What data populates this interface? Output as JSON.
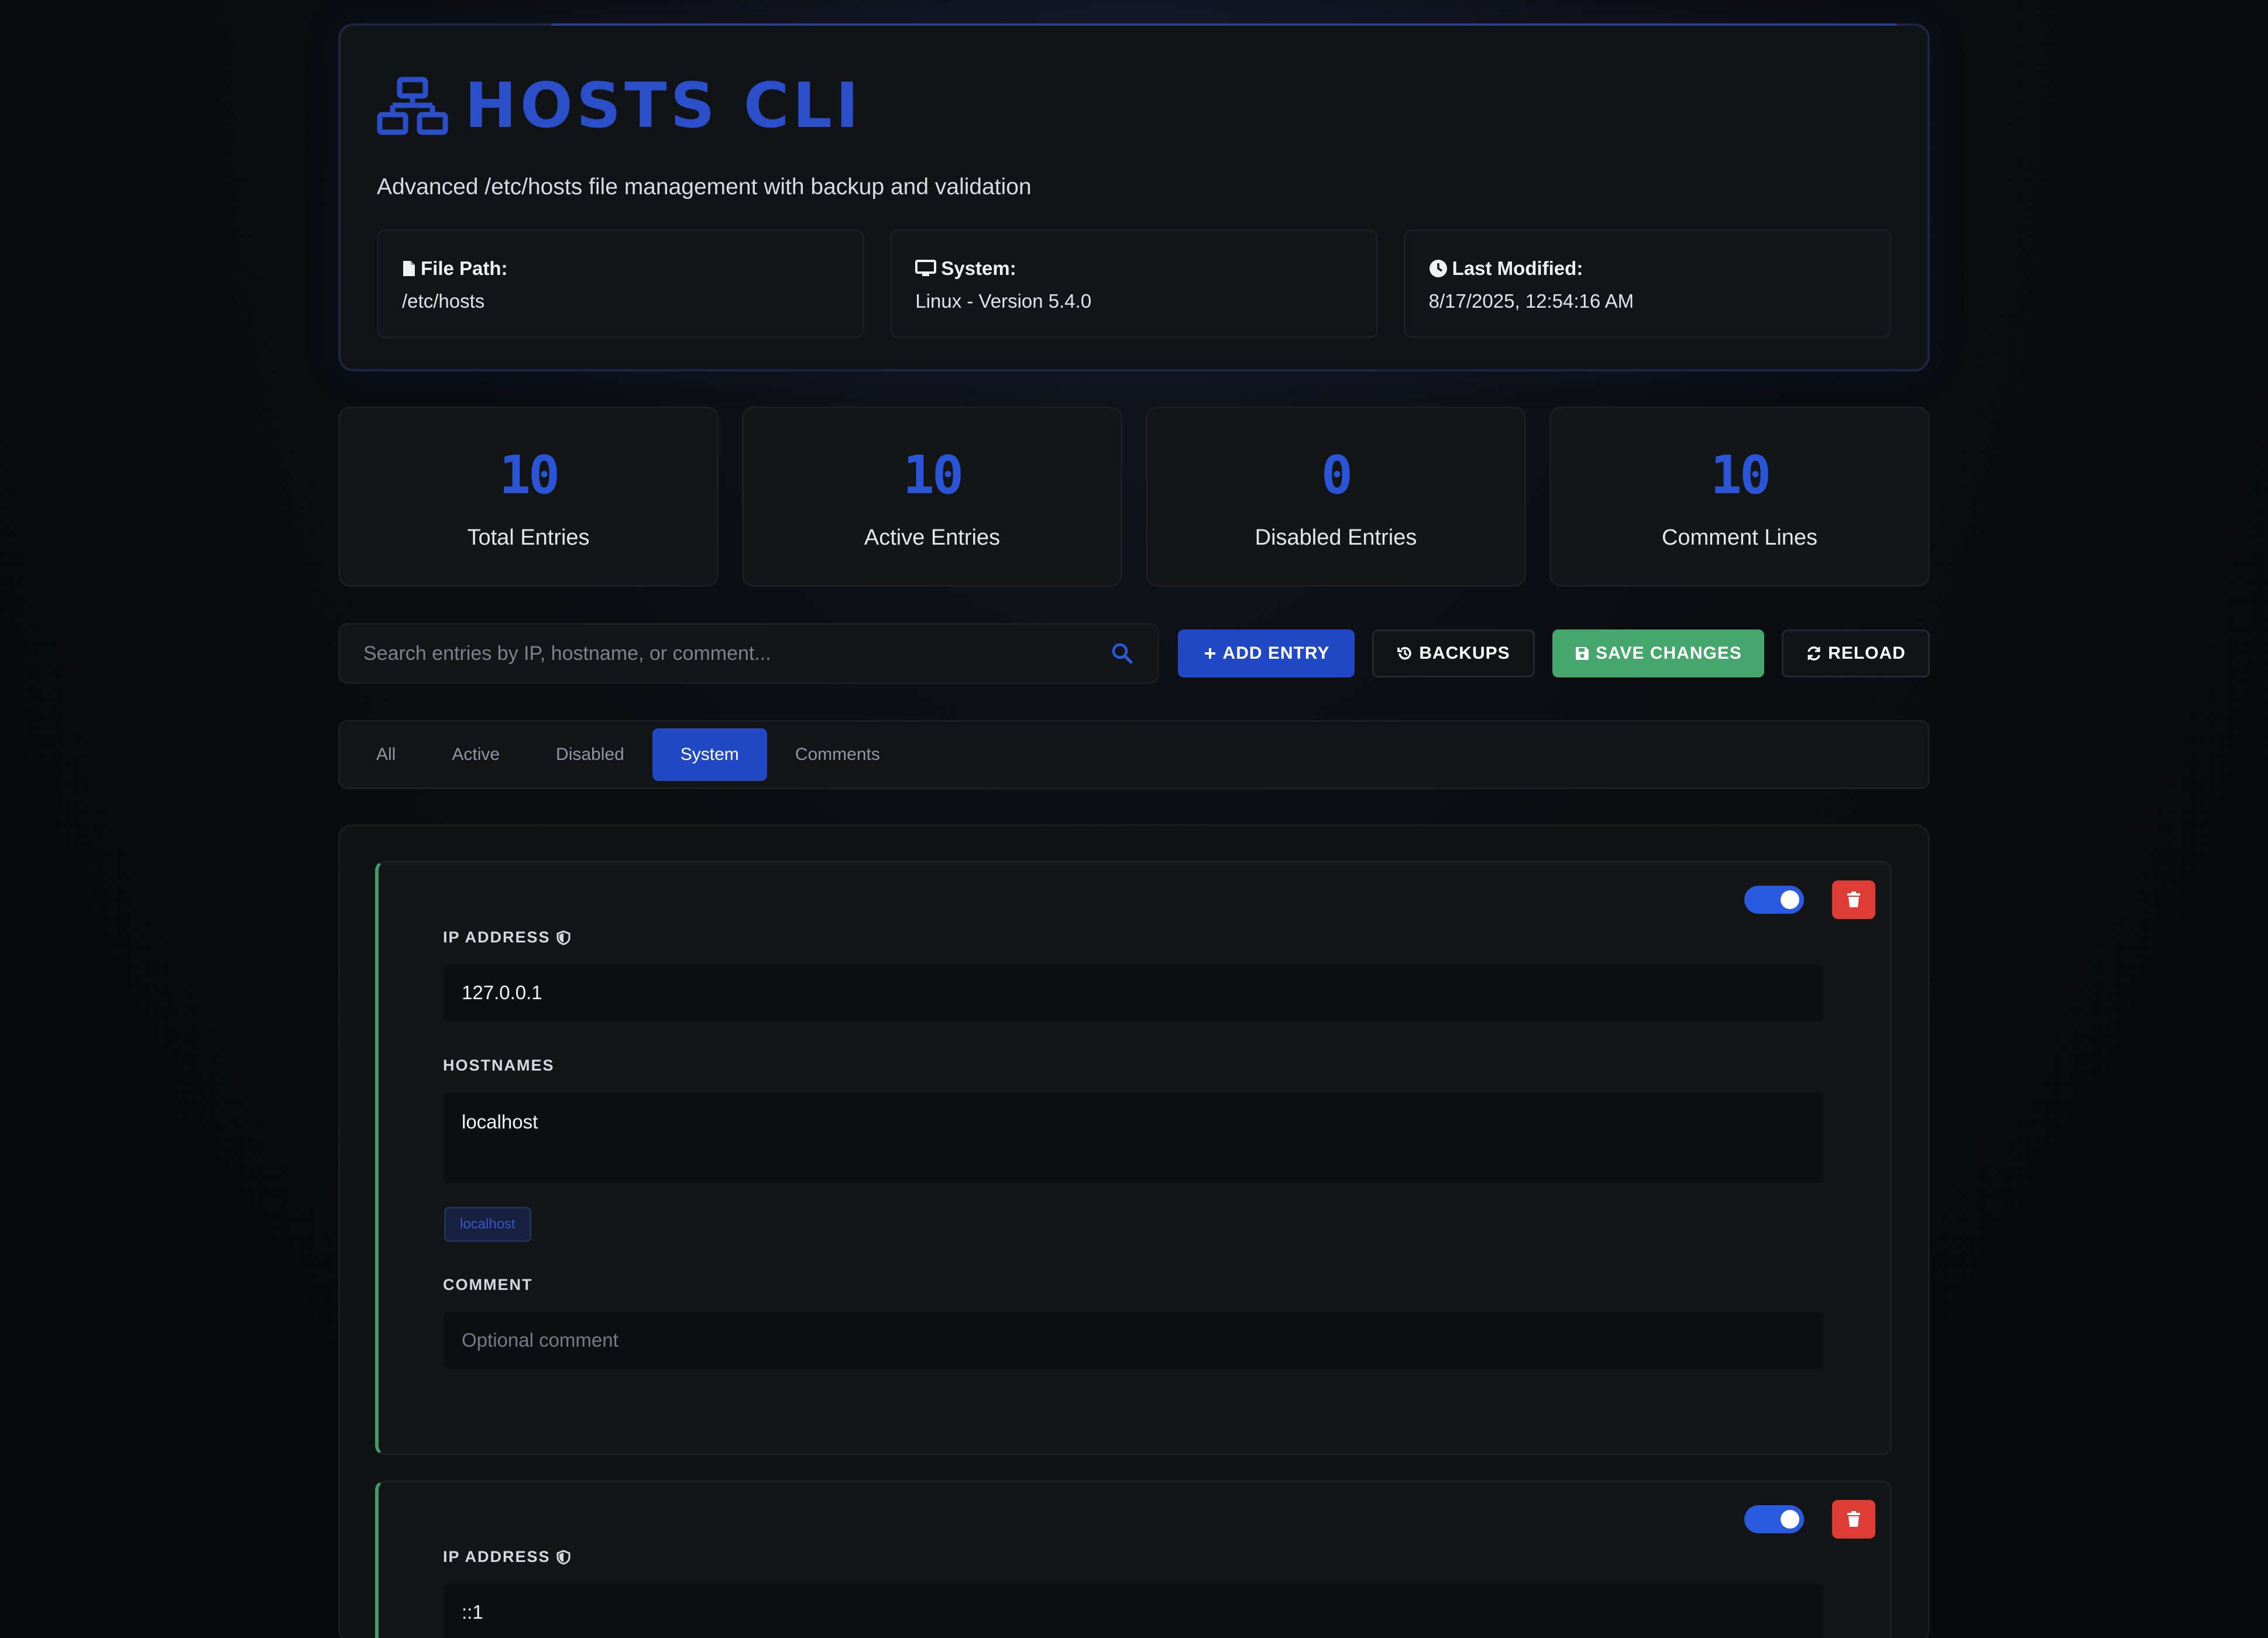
{
  "app": {
    "title": "HOSTS CLI",
    "subtitle": "Advanced /etc/hosts file management with backup and validation",
    "logo_icon": "network-icon",
    "accent_color": "#2a4fc9"
  },
  "info": {
    "file_path_label": "File Path:",
    "file_path_value": "/etc/hosts",
    "system_label": "System:",
    "system_value": "Linux - Version 5.4.0",
    "modified_label": "Last Modified:",
    "modified_value": "8/17/2025, 12:54:16 AM"
  },
  "stats": [
    {
      "value": "10",
      "label": "Total Entries"
    },
    {
      "value": "10",
      "label": "Active Entries"
    },
    {
      "value": "0",
      "label": "Disabled Entries"
    },
    {
      "value": "10",
      "label": "Comment Lines"
    }
  ],
  "toolbar": {
    "search_placeholder": "Search entries by IP, hostname, or comment...",
    "add_label": "ADD ENTRY",
    "backups_label": "BACKUPS",
    "save_label": "SAVE CHANGES",
    "reload_label": "RELOAD",
    "save_color": "#45a76c"
  },
  "tabs": [
    {
      "label": "All",
      "active": false
    },
    {
      "label": "Active",
      "active": false
    },
    {
      "label": "Disabled",
      "active": false
    },
    {
      "label": "System",
      "active": true
    },
    {
      "label": "Comments",
      "active": false
    }
  ],
  "entries": [
    {
      "ip_label": "IP ADDRESS",
      "ip": "127.0.0.1",
      "hostnames_label": "HOSTNAMES",
      "hostnames": "localhost",
      "chips": [
        "localhost"
      ],
      "comment_label": "COMMENT",
      "comment_placeholder": "Optional comment",
      "enabled": true
    },
    {
      "ip_label": "IP ADDRESS",
      "ip": "::1",
      "enabled": true
    }
  ]
}
